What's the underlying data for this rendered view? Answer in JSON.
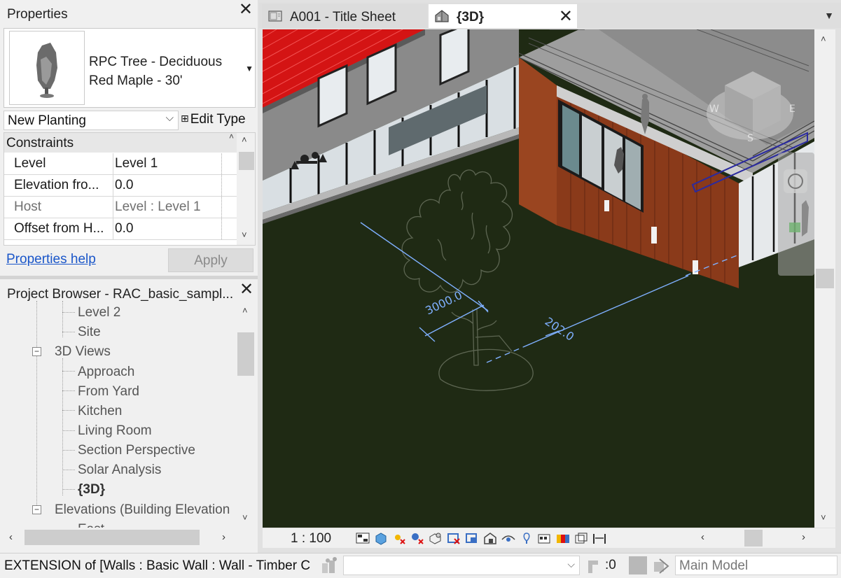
{
  "properties": {
    "title": "Properties",
    "close": "✕",
    "type_name_line1": "RPC Tree - Deciduous",
    "type_name_line2": "Red Maple - 30'",
    "instance_filter": "New Planting",
    "edit_type": "Edit Type",
    "group": "Constraints",
    "rows": [
      {
        "label": "Level",
        "value": "Level 1",
        "muted": false
      },
      {
        "label": "Elevation fro...",
        "value": "0.0",
        "muted": false
      },
      {
        "label": "Host",
        "value": "Level : Level 1",
        "muted": true
      },
      {
        "label": "Offset from H...",
        "value": "0.0",
        "muted": false
      }
    ],
    "help_link": "Properties help",
    "apply": "Apply"
  },
  "browser": {
    "title": "Project Browser - RAC_basic_sampl...",
    "close": "✕",
    "items": [
      {
        "label": "Level 2",
        "level": 2
      },
      {
        "label": "Site",
        "level": 2
      },
      {
        "label": "3D Views",
        "level": 1,
        "expander": "−"
      },
      {
        "label": "Approach",
        "level": 2
      },
      {
        "label": "From Yard",
        "level": 2
      },
      {
        "label": "Kitchen",
        "level": 2
      },
      {
        "label": "Living Room",
        "level": 2
      },
      {
        "label": "Section Perspective",
        "level": 2
      },
      {
        "label": "Solar Analysis",
        "level": 2
      },
      {
        "label": "{3D}",
        "level": 2,
        "bold": true
      },
      {
        "label": "Elevations (Building Elevation",
        "level": 1,
        "expander": "−"
      },
      {
        "label": "East",
        "level": 2
      }
    ]
  },
  "tabs": [
    {
      "label": "A001 - Title Sheet",
      "active": false
    },
    {
      "label": "{3D}",
      "active": true,
      "close": "✕"
    }
  ],
  "view": {
    "dim1": "3000.0",
    "dim2": "202.0",
    "scale": "1 : 100"
  },
  "status": {
    "text": "EXTENSION  of [Walls : Basic Wall : Wall - Timber C",
    "filter_count": ":0",
    "model": "Main Model"
  },
  "colors": {
    "ground": "#1f2a14",
    "roof": "#d41414",
    "timber": "#8a3a1a",
    "link": "#1a56c9",
    "dimension": "#7fb0ff"
  }
}
